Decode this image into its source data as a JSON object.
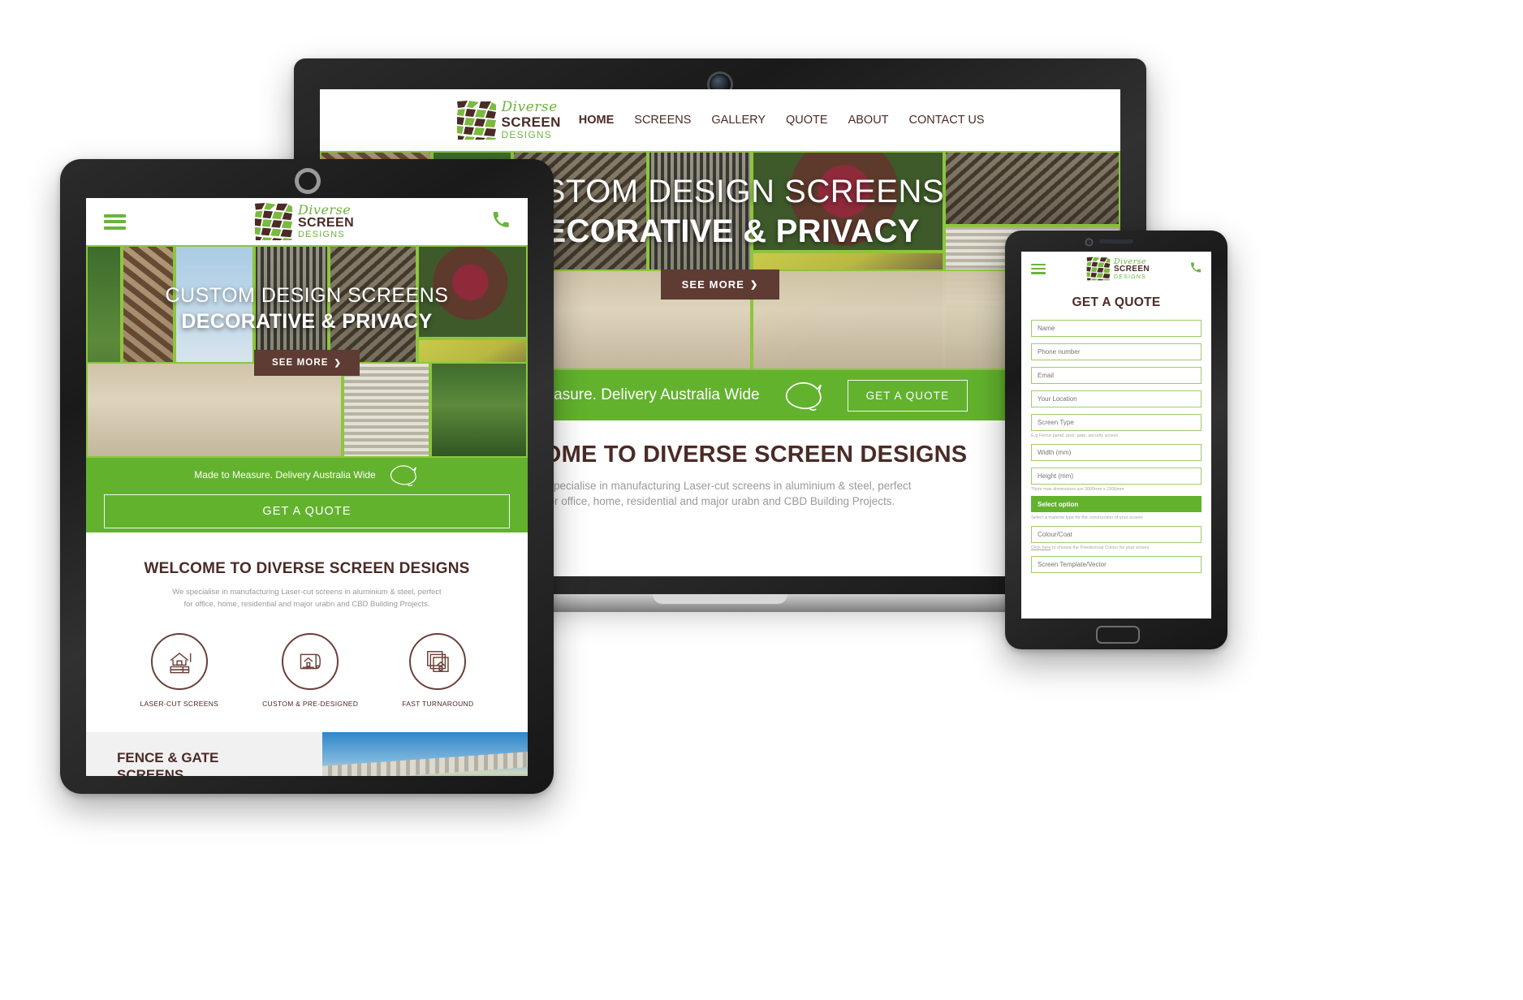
{
  "site": {
    "brand": {
      "diverse": "Diverse",
      "screen": "SCREEN",
      "designs": "DESIGNS"
    },
    "nav_items": [
      {
        "label": "HOME",
        "active": true
      },
      {
        "label": "SCREENS",
        "active": false
      },
      {
        "label": "GALLERY",
        "active": false
      },
      {
        "label": "QUOTE",
        "active": false
      },
      {
        "label": "ABOUT",
        "active": false
      },
      {
        "label": "CONTACT US",
        "active": false
      }
    ],
    "hero": {
      "line1": "CUSTOM DESIGN SCREENS",
      "line2": "DECORATIVE & PRIVACY",
      "cta": "SEE MORE",
      "cta_chevron": "❯"
    },
    "band": {
      "text": "Made to Measure. Delivery Australia Wide",
      "map_icon": "australia-outline-icon",
      "cta": "GET A QUOTE"
    },
    "welcome": {
      "title": "WELCOME TO DIVERSE SCREEN DESIGNS",
      "paragraph_line1": "We specialise in manufacturing Laser-cut screens in aluminium & steel, perfect",
      "paragraph_line2": "for office, home, residential and major urabn and CBD Building Projects.",
      "features": [
        {
          "label": "LASER-CUT SCREENS",
          "icon": "house-panel-icon"
        },
        {
          "label": "CUSTOM & PRE-DESIGNED",
          "icon": "blueprint-roll-icon"
        },
        {
          "label": "FAST TURNAROUND",
          "icon": "stacked-screens-icon"
        }
      ]
    },
    "fence_section": {
      "title_line1": "FENCE & GATE",
      "title_line2": "SCREENS"
    },
    "icons": {
      "hamburger": "hamburger-menu-icon",
      "phone": "phone-handset-icon",
      "phone_glyph": "✆"
    },
    "colors": {
      "green": "#62b22e",
      "logo_green": "#6cb33f",
      "brown": "#4a2b26",
      "button_brown": "#5e3b33",
      "field_border": "#9ccd6b"
    }
  },
  "quote_form": {
    "title": "GET A QUOTE",
    "fields": [
      {
        "placeholder": "Name",
        "hint": ""
      },
      {
        "placeholder": "Phone number",
        "hint": ""
      },
      {
        "placeholder": "Email",
        "hint": ""
      },
      {
        "placeholder": "Your Location",
        "hint": ""
      },
      {
        "placeholder": "Screen Type",
        "hint": "E.g Fence panel, pool, gate, security screen."
      },
      {
        "placeholder": "Width (mm)",
        "hint": ""
      },
      {
        "placeholder": "Height (mm)",
        "hint": "*Note max dimensions are 3000mm x 1500mm"
      }
    ],
    "select": {
      "value": "Select option",
      "hint": "Select a material type for the construction of your screen"
    },
    "colour_field": {
      "placeholder": "Colour/Coat",
      "hint_link": "Click here",
      "hint_rest": " to choose the Powdercoat Colour for your screen"
    },
    "last_field": {
      "placeholder": "Screen Template/Vector"
    }
  }
}
